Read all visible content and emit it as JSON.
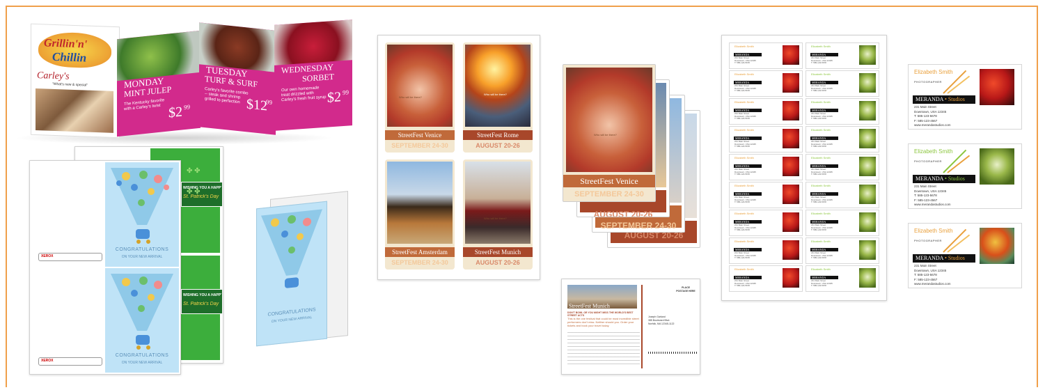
{
  "colors": {
    "frame_border": "#f0a04a",
    "tent_magenta": "#d22a8c",
    "festival_rust": "#a8472a",
    "festival_cream": "#f3e7cf",
    "baby_blue": "#bfe3f7",
    "clover_green": "#3cae3c",
    "meranda_black": "#111111"
  },
  "tent_card": {
    "logo_line1": "Grillin'n'",
    "logo_line2": "Chillin",
    "brand": "Carley's",
    "tagline": "\"What's new & special\"",
    "panels": [
      {
        "day": "MONDAY",
        "item": "MINT JULEP",
        "desc": "The Kentucky favorite with a Carley's twist",
        "price": "$2",
        "cents": "99"
      },
      {
        "day": "TUESDAY",
        "item": "TURF & SURF",
        "desc": "Carley's favorite combo -- steak and shrimp grilled to perfection",
        "price": "$12",
        "cents": "99"
      },
      {
        "day": "WEDNESDAY",
        "item": "SORBET",
        "desc": "Our own homemade treat drizzled with Carley's fresh fruit syrup",
        "price": "$2",
        "cents": "99"
      }
    ]
  },
  "baby_card": {
    "line1": "CONGRATULATIONS",
    "line2": "ON YOUR NEW ARRIVAL"
  },
  "clover_card": {
    "line1": "WISHING YOU A HAPPY",
    "line2": "St. Patrick's Day"
  },
  "streetfest": {
    "posters": [
      {
        "city": "StreetFest Venice",
        "date": "SEPTEMBER 24-30",
        "ribbon": "Who will be there?"
      },
      {
        "city": "StreetFest Rome",
        "date": "AUGUST 20-26",
        "ribbon": "Who will be there?"
      },
      {
        "city": "StreetFest Amsterdam",
        "date": "SEPTEMBER 24-30",
        "ribbon": ""
      },
      {
        "city": "StreetFest Munich",
        "date": "AUGUST 20-26",
        "ribbon": "Who will be there?"
      }
    ],
    "stack": {
      "city": "StreetFest Venice",
      "date": "SEPTEMBER 24-30",
      "back_dates": [
        "AUGUST 20-26",
        "SEPTEMBER 24-30",
        "AUGUST 20-26"
      ],
      "ribbon": "Who will be there?"
    }
  },
  "postcard": {
    "title": "StreetFest Munich",
    "headline": "DON'T BOWL OR YOU MIGHT MISS THE WORLD'S BEST STREET ACTS",
    "intro": "This is the one festival that could be most incredible street performers don't miss. Neither should you. Order your tickets and book your travel today.",
    "stamp": "PLACE POSTAGE HERE",
    "recipient": "Joseph Garland\n385 Boulevard Blvd.\nNorfolk, MA  12345-1122"
  },
  "meranda": {
    "name": "Elizabeth Smith",
    "title": "PHOTOGRAPHER",
    "logo_main": "MERANDA",
    "logo_sep": "•",
    "logo_sub": "Studios",
    "address1": "231 Main Street",
    "address2": "Downtown, USA 12345",
    "phone": "T: 585-123-5678",
    "fax": "F: 585-123-4567",
    "web": "www.merandastudios.com",
    "name_colors": [
      "#e9a03c",
      "#8cc63f",
      "#e9a03c"
    ]
  },
  "xerox_label": "XEROX"
}
